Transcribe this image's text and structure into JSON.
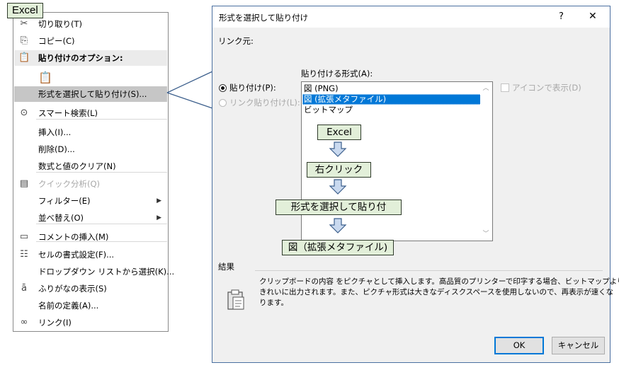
{
  "tag_label": "Excel",
  "menu": {
    "items": [
      {
        "icon": "scissors-icon",
        "glyph": "✂",
        "label": "切り取り(T)",
        "state": "normal"
      },
      {
        "icon": "copy-icon",
        "glyph": "⎘",
        "label": "コピー(C)",
        "state": "normal"
      },
      {
        "icon": "clipboard-icon",
        "glyph": "📋",
        "label": "貼り付けのオプション:",
        "state": "header"
      },
      {
        "icon": "paste-option-icon",
        "glyph": "📋",
        "label": "",
        "state": "normal"
      },
      {
        "icon": "",
        "glyph": "",
        "label": "形式を選択して貼り付け(S)...",
        "state": "highlighted"
      },
      {
        "icon": "smart-search-icon",
        "glyph": "⊙",
        "label": "スマート検索(L)",
        "state": "normal"
      },
      {
        "icon": "",
        "glyph": "",
        "label": "挿入(I)...",
        "state": "normal"
      },
      {
        "icon": "",
        "glyph": "",
        "label": "削除(D)...",
        "state": "normal"
      },
      {
        "icon": "",
        "glyph": "",
        "label": "数式と値のクリア(N)",
        "state": "normal"
      },
      {
        "icon": "quick-analysis-icon",
        "glyph": "▤",
        "label": "クイック分析(Q)",
        "state": "disabled"
      },
      {
        "icon": "",
        "glyph": "",
        "label": "フィルター(E)",
        "state": "submenu"
      },
      {
        "icon": "",
        "glyph": "",
        "label": "並べ替え(O)",
        "state": "submenu"
      },
      {
        "icon": "comment-icon",
        "glyph": "▭",
        "label": "コメントの挿入(M)",
        "state": "normal"
      },
      {
        "icon": "format-cells-icon",
        "glyph": "☷",
        "label": "セルの書式設定(F)...",
        "state": "normal"
      },
      {
        "icon": "",
        "glyph": "",
        "label": "ドロップダウン リストから選択(K)...",
        "state": "normal"
      },
      {
        "icon": "phonetic-icon",
        "glyph": "ā",
        "label": "ふりがなの表示(S)",
        "state": "normal"
      },
      {
        "icon": "",
        "glyph": "",
        "label": "名前の定義(A)...",
        "state": "normal"
      },
      {
        "icon": "link-icon",
        "glyph": "∞",
        "label": "リンク(I)",
        "state": "normal"
      }
    ]
  },
  "dialog": {
    "title": "形式を選択して貼り付け",
    "help": "?",
    "close": "✕",
    "source_label": "リンク元:",
    "format_label": "貼り付ける形式(A):",
    "radio_paste": "貼り付け(P):",
    "radio_link": "リンク貼り付け(L):",
    "formats": [
      "図 (PNG)",
      "図 (拡張メタファイル)",
      "ビットマップ"
    ],
    "selected_format": 1,
    "checkbox_icon": "アイコンで表示(D)",
    "result_label": "結果",
    "result_text_1": "クリップボードの内容 をピクチャとして挿入します。高品質のプリンターで印字する場合、ビットマップよりも",
    "result_text_2": "きれいに出力されます。また、ピクチャ形式は大きなディスクスペースを使用しないので、再表示が速くな",
    "result_text_3": "ります。",
    "ok": "OK",
    "cancel": "キャンセル"
  },
  "flow_steps": [
    "Excel",
    "右クリック",
    "形式を選択して貼り付",
    "図（拡張メタファイル)"
  ]
}
